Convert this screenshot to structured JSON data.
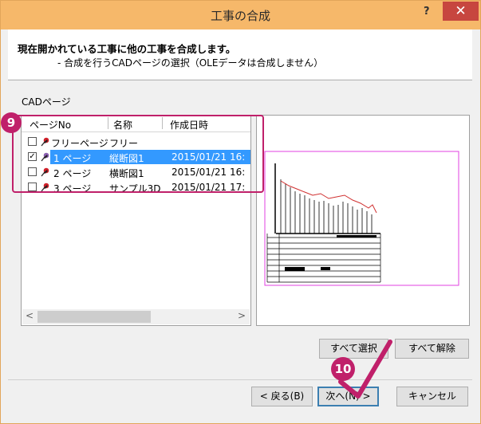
{
  "window": {
    "title": "工事の合成",
    "help": "?",
    "close": "✕"
  },
  "header": {
    "title": "現在開かれている工事に他の工事を合成します。",
    "subtitle": "- 合成を行うCADページの選択（OLEデータは合成しません）"
  },
  "section_label": "CADページ",
  "listview": {
    "columns": [
      "ページNo",
      "名称",
      "作成日時"
    ],
    "rows": [
      {
        "checked": false,
        "page": "フリーページ",
        "name": "フリー",
        "date": "",
        "selected": false
      },
      {
        "checked": true,
        "page": "1 ページ",
        "name": "縦断図1",
        "date": "2015/01/21 16:",
        "selected": true
      },
      {
        "checked": false,
        "page": "2 ページ",
        "name": "横断図1",
        "date": "2015/01/21 16:",
        "selected": false
      },
      {
        "checked": false,
        "page": "3 ページ",
        "name": "サンプル3D",
        "date": "2015/01/21 17:",
        "selected": false
      }
    ],
    "scroll_left": "<",
    "scroll_right": ">"
  },
  "buttons": {
    "select_all": "すべて選択",
    "clear_all": "すべて解除",
    "back": "< 戻る(B)",
    "next": "次へ(N) >",
    "cancel": "キャンセル"
  },
  "annotations": {
    "badge_9": "9",
    "badge_10": "10"
  },
  "colors": {
    "titlebar": "#f6b86a",
    "close": "#c7463f",
    "selection": "#3399ff",
    "annotation": "#c0206a"
  }
}
